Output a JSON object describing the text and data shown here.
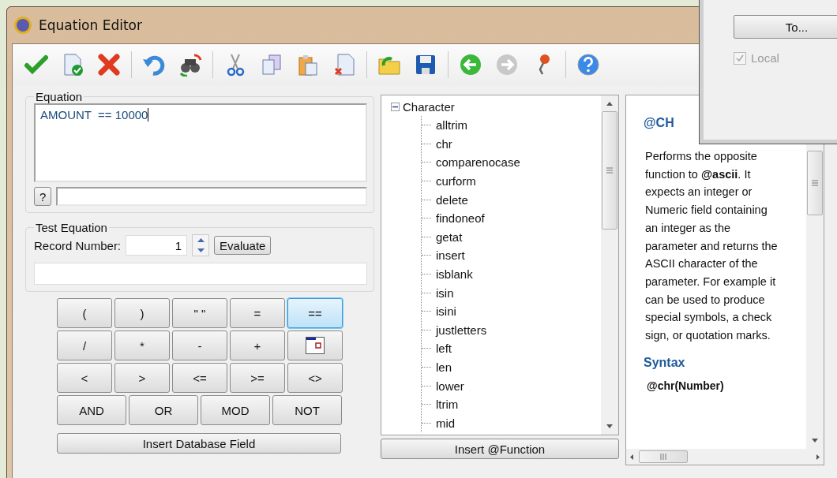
{
  "window": {
    "title": "Equation Editor"
  },
  "equation": {
    "label": "Equation",
    "value": "AMOUNT  == 10000",
    "help_button": "?"
  },
  "test": {
    "label": "Test Equation",
    "record_label": "Record Number:",
    "record_value": "1",
    "evaluate_button": "Evaluate"
  },
  "keypad": [
    {
      "kind": "text",
      "label": "(",
      "highlighted": false
    },
    {
      "kind": "text",
      "label": ")",
      "highlighted": false
    },
    {
      "kind": "text",
      "label": "\" \"",
      "highlighted": false
    },
    {
      "kind": "text",
      "label": "=",
      "highlighted": false
    },
    {
      "kind": "text",
      "label": "==",
      "highlighted": true
    },
    {
      "kind": "text",
      "label": "/",
      "highlighted": false
    },
    {
      "kind": "text",
      "label": "*",
      "highlighted": false
    },
    {
      "kind": "text",
      "label": "-",
      "highlighted": false
    },
    {
      "kind": "text",
      "label": "+",
      "highlighted": false
    },
    {
      "kind": "icon",
      "highlighted": false
    },
    {
      "kind": "text",
      "label": "<",
      "highlighted": false
    },
    {
      "kind": "text",
      "label": ">",
      "highlighted": false
    },
    {
      "kind": "text",
      "label": "<=",
      "highlighted": false
    },
    {
      "kind": "text",
      "label": ">=",
      "highlighted": false
    },
    {
      "kind": "text",
      "label": "<>",
      "highlighted": false
    }
  ],
  "logic_buttons": [
    "AND",
    "OR",
    "MOD",
    "NOT"
  ],
  "insert_field_button": "Insert Database Field",
  "function_tree": {
    "label": "Character",
    "expanded": true,
    "children": [
      "alltrim",
      "chr",
      "comparenocase",
      "curform",
      "delete",
      "findoneof",
      "getat",
      "insert",
      "isblank",
      "isin",
      "isini",
      "justletters",
      "left",
      "len",
      "lower",
      "ltrim",
      "mid"
    ]
  },
  "insert_function_button": "Insert @Function",
  "help": {
    "heading": "@CH",
    "description": "Performs the opposite function to **@ascii**. It expects an integer or Numeric field containing an integer as the parameter and returns the ASCII character of the parameter.  For example it can be used to produce special symbols, a check sign, or quotation marks.",
    "syntax_heading": "Syntax",
    "syntax": "@chr(Number)"
  },
  "background_dialog": {
    "button": "To...",
    "checkbox": {
      "label": "Local",
      "checked": true,
      "disabled": true
    }
  }
}
